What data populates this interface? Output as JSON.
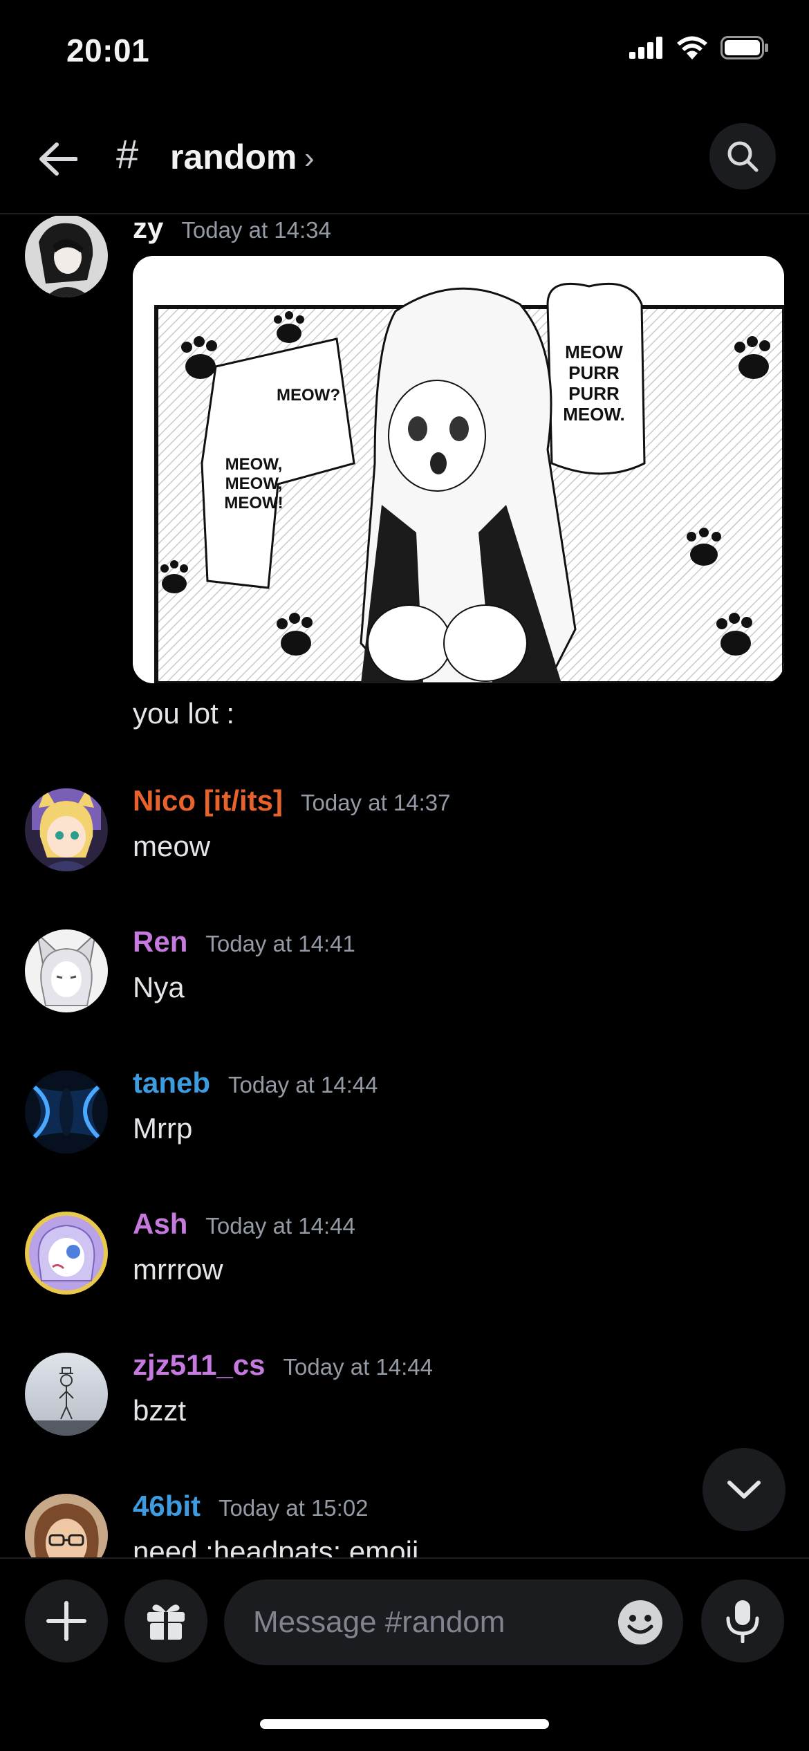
{
  "status_bar": {
    "time": "20:01"
  },
  "header": {
    "hash": "#",
    "channel": "random",
    "chevron": "›"
  },
  "colors": {
    "nico": "#e8622c",
    "ren": "#c67ae0",
    "taneb": "#3d9bdf",
    "ash": "#c67ae0",
    "zjz": "#c67ae0",
    "bit46": "#3d9bdf"
  },
  "messages": [
    {
      "author": "zy",
      "time": "Today at 14:34",
      "text": "you lot :",
      "attachment": {
        "bubble_left_top": "MEOW?",
        "bubble_left_bottom": "MEOW, MEOW, MEOW!",
        "bubble_right": "MEOW PURR PURR MEOW."
      }
    },
    {
      "author": "Nico [it/its]",
      "time": "Today at 14:37",
      "text": "meow"
    },
    {
      "author": "Ren",
      "time": "Today at 14:41",
      "text": "Nya"
    },
    {
      "author": "taneb",
      "time": "Today at 14:44",
      "text": "Mrrp"
    },
    {
      "author": "Ash",
      "time": "Today at 14:44",
      "text": "mrrrow"
    },
    {
      "author": "zjz511_cs",
      "time": "Today at 14:44",
      "text": "bzzt"
    },
    {
      "author": "46bit",
      "time": "Today at 15:02",
      "text": "need :headpats: emoji"
    }
  ],
  "composer": {
    "placeholder": "Message #random"
  },
  "icons": [
    "back-arrow-icon",
    "search-icon",
    "chevron-down-icon",
    "plus-icon",
    "gift-icon",
    "emoji-icon",
    "microphone-icon"
  ]
}
